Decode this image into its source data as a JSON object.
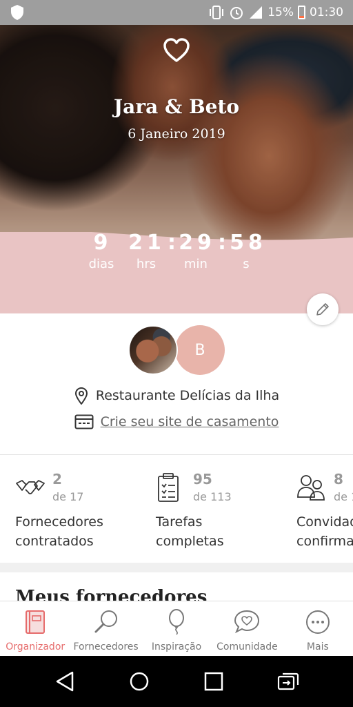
{
  "status_bar": {
    "battery": "15%",
    "time": "01:30"
  },
  "hero": {
    "couple_name": "Jara & Beto",
    "date": "6 Janeiro 2019"
  },
  "countdown": {
    "days": "9",
    "hours": "21",
    "minutes": "29",
    "seconds": "58",
    "days_label": "dias",
    "hours_label": "hrs",
    "minutes_label": "min",
    "seconds_label": "s",
    "separator": ":"
  },
  "profile": {
    "initial": "B",
    "venue": "Restaurante Delícias da Ilha",
    "website_link": "Crie seu site de casamento"
  },
  "stats": [
    {
      "count": "2",
      "total": "de 17",
      "label": "Fornecedores\ncontratados",
      "icon": "handshake-icon"
    },
    {
      "count": "95",
      "total": "de 113",
      "label": "Tarefas\ncompletas",
      "icon": "clipboard-icon"
    },
    {
      "count": "8",
      "total": "de 1",
      "label": "Convidados\nconfirmados",
      "icon": "guests-icon"
    }
  ],
  "section": {
    "title": "Meus fornecedores"
  },
  "bottom_nav": [
    {
      "label": "Organizador",
      "icon": "notebook-icon",
      "active": true
    },
    {
      "label": "Fornecedores",
      "icon": "magnifier-icon",
      "active": false
    },
    {
      "label": "Inspiração",
      "icon": "balloon-icon",
      "active": false
    },
    {
      "label": "Comunidade",
      "icon": "chat-heart-icon",
      "active": false
    },
    {
      "label": "Mais",
      "icon": "more-icon",
      "active": false
    }
  ],
  "colors": {
    "accent": "#e66b6b",
    "countdown_band": "#e9c4c4",
    "avatar_initial_bg": "#e8b4aa"
  }
}
